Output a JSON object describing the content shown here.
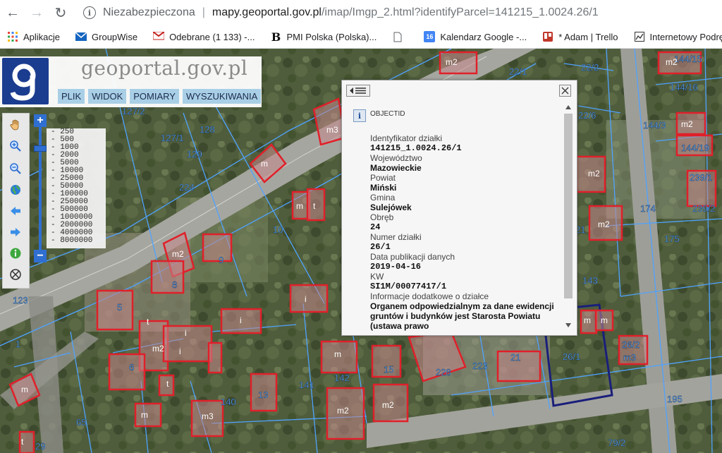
{
  "browser": {
    "not_secure": "Niezabezpieczona",
    "host": "mapy.geoportal.gov.pl",
    "path": "/imap/Imgp_2.html?identifyParcel=141215_1.0024.26/1",
    "bookmarks": [
      {
        "label": "Aplikacje",
        "icon": "apps-grid-icon"
      },
      {
        "label": "GroupWise",
        "icon": "mail-icon"
      },
      {
        "label": "Odebrane (1 133) -...",
        "icon": "gmail-icon"
      },
      {
        "label": "PMI Polska (Polska)...",
        "icon": "pmi-b-icon"
      },
      {
        "label": "",
        "icon": "document-icon"
      },
      {
        "label": "Kalendarz Google -...",
        "icon": "calendar-16-icon"
      },
      {
        "label": "* Adam | Trello",
        "icon": "trello-icon"
      },
      {
        "label": "Internetowy Podręc",
        "icon": "chart-icon"
      }
    ]
  },
  "app": {
    "logo_text": "geoportal.gov.pl",
    "menu": [
      "PLIK",
      "WIDOK",
      "POMIARY",
      "WYSZUKIWANIA"
    ],
    "zoom_plus": "+",
    "zoom_minus": "−",
    "scales": [
      "- 250",
      "- 500",
      "- 1000",
      "- 2000",
      "- 5000",
      "- 10000",
      "- 25000",
      "- 50000",
      "- 100000",
      "- 250000",
      "- 500000",
      "- 1000000",
      "- 2000000",
      "- 4000000",
      "- 8000000"
    ]
  },
  "popup": {
    "objectid": "OBJECTID",
    "fields": [
      {
        "label": "Identyfikator działki",
        "value": "141215_1.0024.26/1"
      },
      {
        "label": "Województwo",
        "value": "Mazowieckie"
      },
      {
        "label": "Powiat",
        "value": "Miński"
      },
      {
        "label": "Gmina",
        "value": "Sulejówek"
      },
      {
        "label": "Obręb",
        "value": "24"
      },
      {
        "label": "Numer działki",
        "value": "26/1"
      },
      {
        "label": "Data publikacji danych",
        "value": "2019-04-16"
      },
      {
        "label": "KW",
        "value": "SI1M/00077417/1"
      },
      {
        "label": "Informacje dodatkowe o działce",
        "value": "Organem odpowiedzialnym za dane ewidencji gruntów i budynków jest Starosta Powiatu (ustawa prawo"
      }
    ]
  },
  "map_labels": [
    "127/2",
    "127/1",
    "128",
    "129",
    "224",
    "10",
    "9",
    "8",
    "5",
    "6",
    "123",
    "1",
    "65",
    "29",
    "140",
    "13",
    "141",
    "142",
    "15",
    "228",
    "223",
    "21",
    "26/1",
    "26/2",
    "m3",
    "195",
    "79/2",
    "143",
    "174",
    "175",
    "144/3",
    "144/15",
    "144/16",
    "144/19",
    "239/1",
    "239/2",
    "22/1",
    "22/2",
    "22/6",
    "21",
    "m2",
    "m",
    "t",
    "i"
  ],
  "colors": {
    "parcel_line": "#4fa3ff",
    "building": "#e0202a",
    "selected": "#1a1f7a",
    "accent": "#2f6fd1"
  }
}
